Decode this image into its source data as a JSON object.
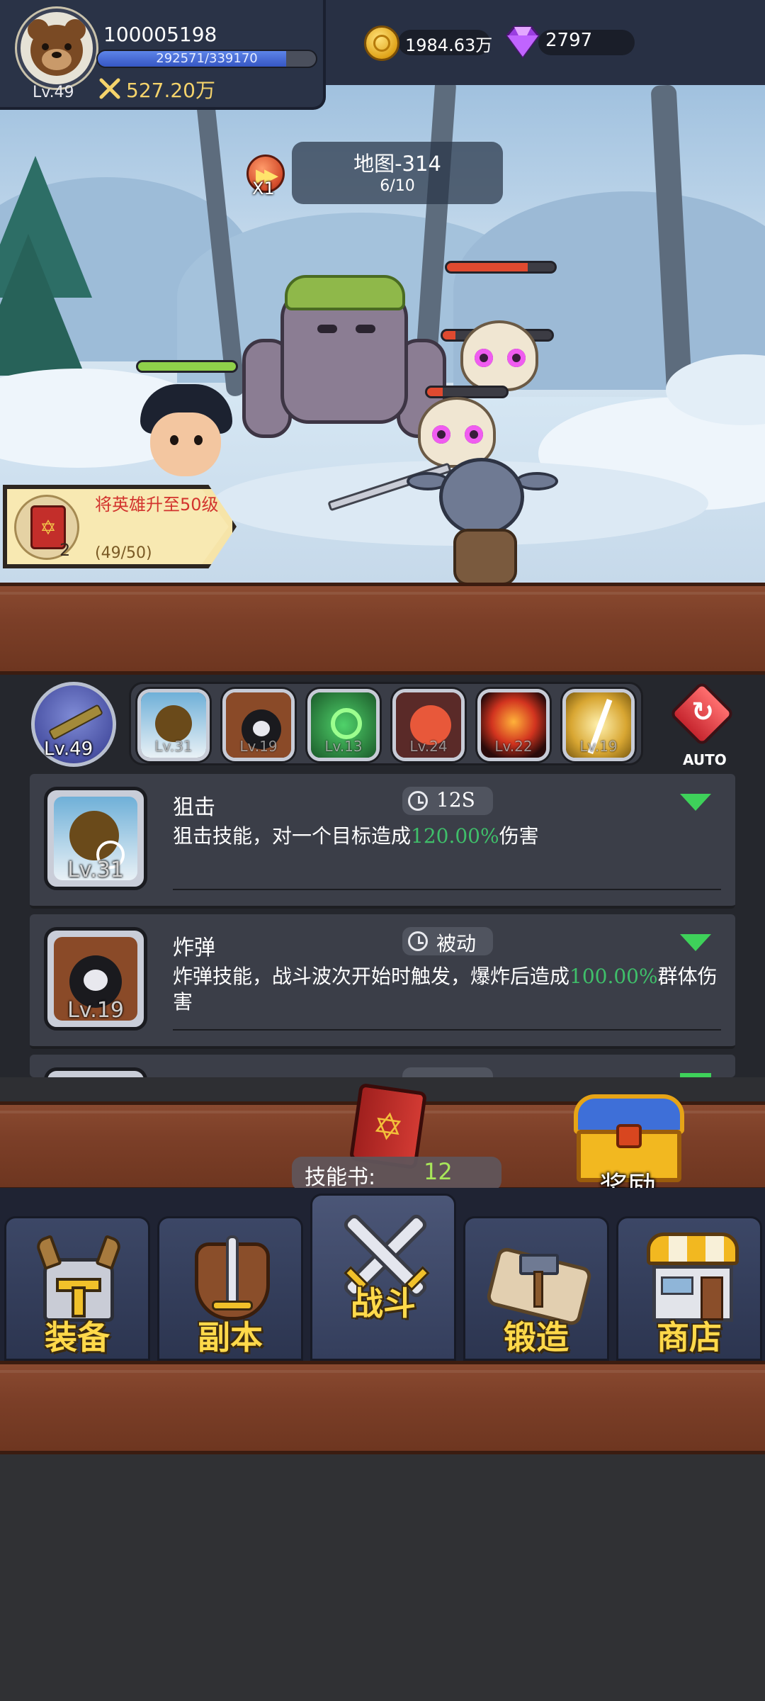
{
  "player": {
    "id": "100005198",
    "level": "Lv.49",
    "exp_text": "292571/339170",
    "exp_fraction": 0.863,
    "power": "527.20万"
  },
  "currency": {
    "gold": "1984.63万",
    "gems": "2797"
  },
  "map": {
    "speed": "X1",
    "name": "地图-314",
    "wave": "6/10"
  },
  "battle": {
    "hero_hp_fraction": 1.0,
    "enemy_hp_fractions": [
      0.75,
      0.12,
      0.2
    ]
  },
  "quest": {
    "item_count": "2",
    "title": "将英雄升至50级",
    "progress": "(49/50)"
  },
  "weapon": {
    "level": "Lv.49"
  },
  "skill_slots": [
    {
      "level": "Lv.31",
      "icon": "sniper-skill-icon"
    },
    {
      "level": "Lv.19",
      "icon": "bomb-skill-icon"
    },
    {
      "level": "Lv.13",
      "icon": "poison-skill-icon"
    },
    {
      "level": "Lv.24",
      "icon": "fire-creature-skill-icon"
    },
    {
      "level": "Lv.22",
      "icon": "meteor-skill-icon"
    },
    {
      "level": "Lv.19",
      "icon": "lightning-skill-icon"
    }
  ],
  "auto_label": "AUTO",
  "skills": [
    {
      "name": "狙击",
      "level": "Lv.31",
      "cooldown": "12S",
      "desc_prefix": "狙击技能，对一个目标造成",
      "desc_value": "120.00%",
      "desc_suffix": "伤害"
    },
    {
      "name": "炸弹",
      "level": "Lv.19",
      "cooldown": "被动",
      "desc_prefix": "炸弹技能，战斗波次开始时触发，爆炸后造成",
      "desc_value": "100.00%",
      "desc_suffix": "群体伤害"
    }
  ],
  "skill_book": {
    "label": "技能书:",
    "count": "12"
  },
  "reward_label": "奖励",
  "nav": [
    {
      "label": "装备",
      "icon": "helmet-icon"
    },
    {
      "label": "副本",
      "icon": "sword-shield-icon"
    },
    {
      "label": "战斗",
      "icon": "crossed-swords-icon"
    },
    {
      "label": "锻造",
      "icon": "hammer-scroll-icon"
    },
    {
      "label": "商店",
      "icon": "shop-icon"
    }
  ],
  "colors": {
    "highlight_green": "#3fbf6a",
    "gold_text": "#ffd94a",
    "quest_red": "#d2332d"
  }
}
